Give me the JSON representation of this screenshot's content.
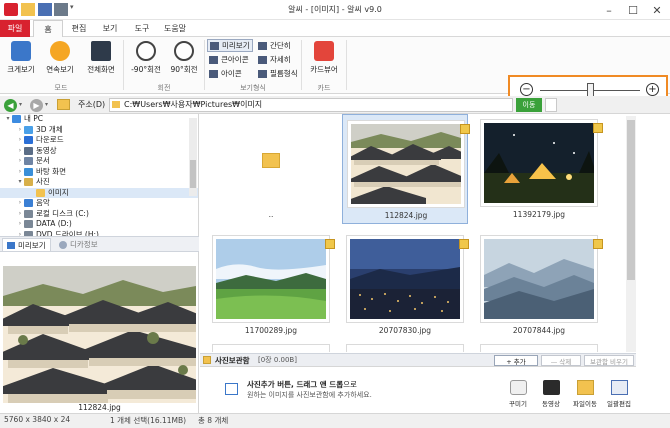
{
  "window": {
    "title": "알씨 - [이미지] - 알씨 v9.0"
  },
  "ribbon": {
    "tabs": [
      "파일",
      "홈",
      "편집",
      "보기",
      "도구",
      "도움말"
    ],
    "groups": {
      "mode": {
        "label": "모드",
        "buttons": [
          "크게보기",
          "연속보기",
          "전체화면"
        ]
      },
      "rotate": {
        "label": "회전",
        "buttons": [
          "-90°회전",
          "90°회전"
        ]
      },
      "view_format": {
        "label": "보기형식",
        "options": [
          "미리보기",
          "큰아이콘",
          "아이콘",
          "간단히",
          "자세히",
          "필름형식"
        ],
        "selected": "미리보기"
      },
      "card": {
        "label": "카드",
        "buttons": [
          "카드뷰어"
        ]
      }
    }
  },
  "zoom": {
    "level": 0.5
  },
  "address": {
    "label": "주소(D)",
    "path": "C:₩Users₩사용자₩Pictures₩이미지",
    "upload_label": "이동"
  },
  "tree": {
    "items": [
      {
        "label": "내 PC",
        "depth": 0,
        "icon": "pc-icon",
        "color": "#3c8be0"
      },
      {
        "label": "3D 개체",
        "depth": 1,
        "icon": "3d-objects-icon",
        "color": "#4aa0e8"
      },
      {
        "label": "다운로드",
        "depth": 1,
        "icon": "download-icon",
        "color": "#2b6fd6"
      },
      {
        "label": "동영상",
        "depth": 1,
        "icon": "video-icon",
        "color": "#5b6d86"
      },
      {
        "label": "문서",
        "depth": 1,
        "icon": "document-icon",
        "color": "#6f84a3"
      },
      {
        "label": "바탕 화면",
        "depth": 1,
        "icon": "desktop-icon",
        "color": "#3a8fd8"
      },
      {
        "label": "사진",
        "depth": 1,
        "icon": "pictures-icon",
        "color": "#d8b04a"
      },
      {
        "label": "이미지",
        "depth": 2,
        "icon": "folder-icon",
        "color": "#f2c24f"
      },
      {
        "label": "음악",
        "depth": 1,
        "icon": "music-icon",
        "color": "#3b7fd4"
      },
      {
        "label": "로컬 디스크 (C:)",
        "depth": 1,
        "icon": "drive-icon",
        "color": "#7a8796"
      },
      {
        "label": "DATA (D:)",
        "depth": 1,
        "icon": "drive-icon",
        "color": "#7a8796"
      },
      {
        "label": "DVD 드라이브 (H:)",
        "depth": 1,
        "icon": "dvd-icon",
        "color": "#7a8796"
      }
    ],
    "selected": "이미지"
  },
  "preview": {
    "tabs": [
      "미리보기",
      "디카정보"
    ],
    "filename": "112824.jpg"
  },
  "grid": {
    "files": [
      {
        "name": "..",
        "kind": "parent-folder"
      },
      {
        "name": "112824.jpg",
        "kind": "hanok",
        "selected": true
      },
      {
        "name": "11392179.jpg",
        "kind": "camp"
      },
      {
        "name": "11700289.jpg",
        "kind": "meadow"
      },
      {
        "name": "20707830.jpg",
        "kind": "city"
      },
      {
        "name": "20707844.jpg",
        "kind": "mountains"
      }
    ]
  },
  "album": {
    "title": "사진보관함",
    "count": "[0장 0.00B]",
    "add_label": "+ 추가",
    "delete_label": "— 삭제",
    "clear_label": "보관함 비우기",
    "hint_main_bold": "사진추가 버튼, 드래그 앤 드롭",
    "hint_main_rest": "으로",
    "hint_sub": "원하는 이미지를 사진보관함에 추가하세요.",
    "actions": [
      "꾸미기",
      "동영상",
      "파일이동",
      "일괄편집"
    ]
  },
  "status": {
    "dimensions": "5760 x 3840 x 24",
    "selection": "1 개체 선택(16.11MB)",
    "total": "총 8 개체"
  },
  "colors": {
    "accent_red": "#d8222f",
    "selection_blue": "#dbe8f7",
    "zoom_highlight": "#f08a24"
  }
}
